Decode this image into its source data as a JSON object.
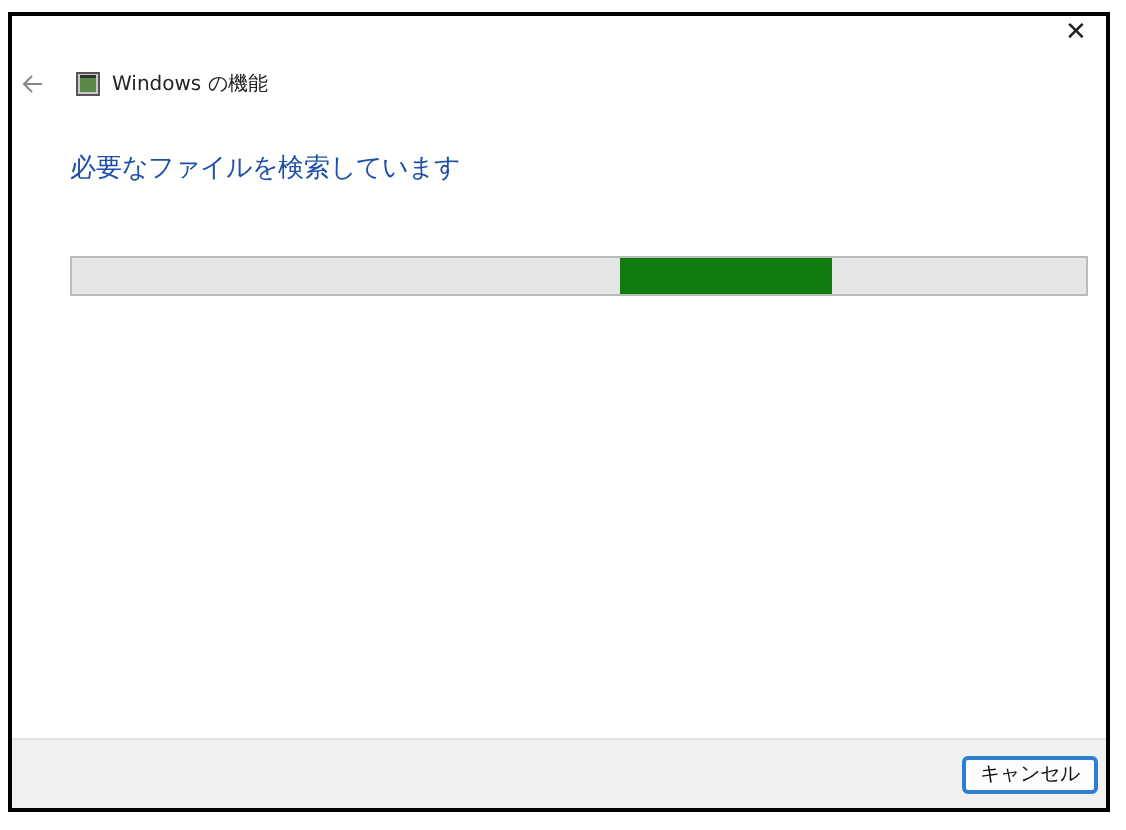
{
  "window": {
    "title": "Windows の機能",
    "close": "✕"
  },
  "heading": "必要なファイルを検索しています",
  "progress": {
    "indeterminate": true
  },
  "buttons": [
    {
      "label": "キャンセル",
      "default": true
    }
  ]
}
